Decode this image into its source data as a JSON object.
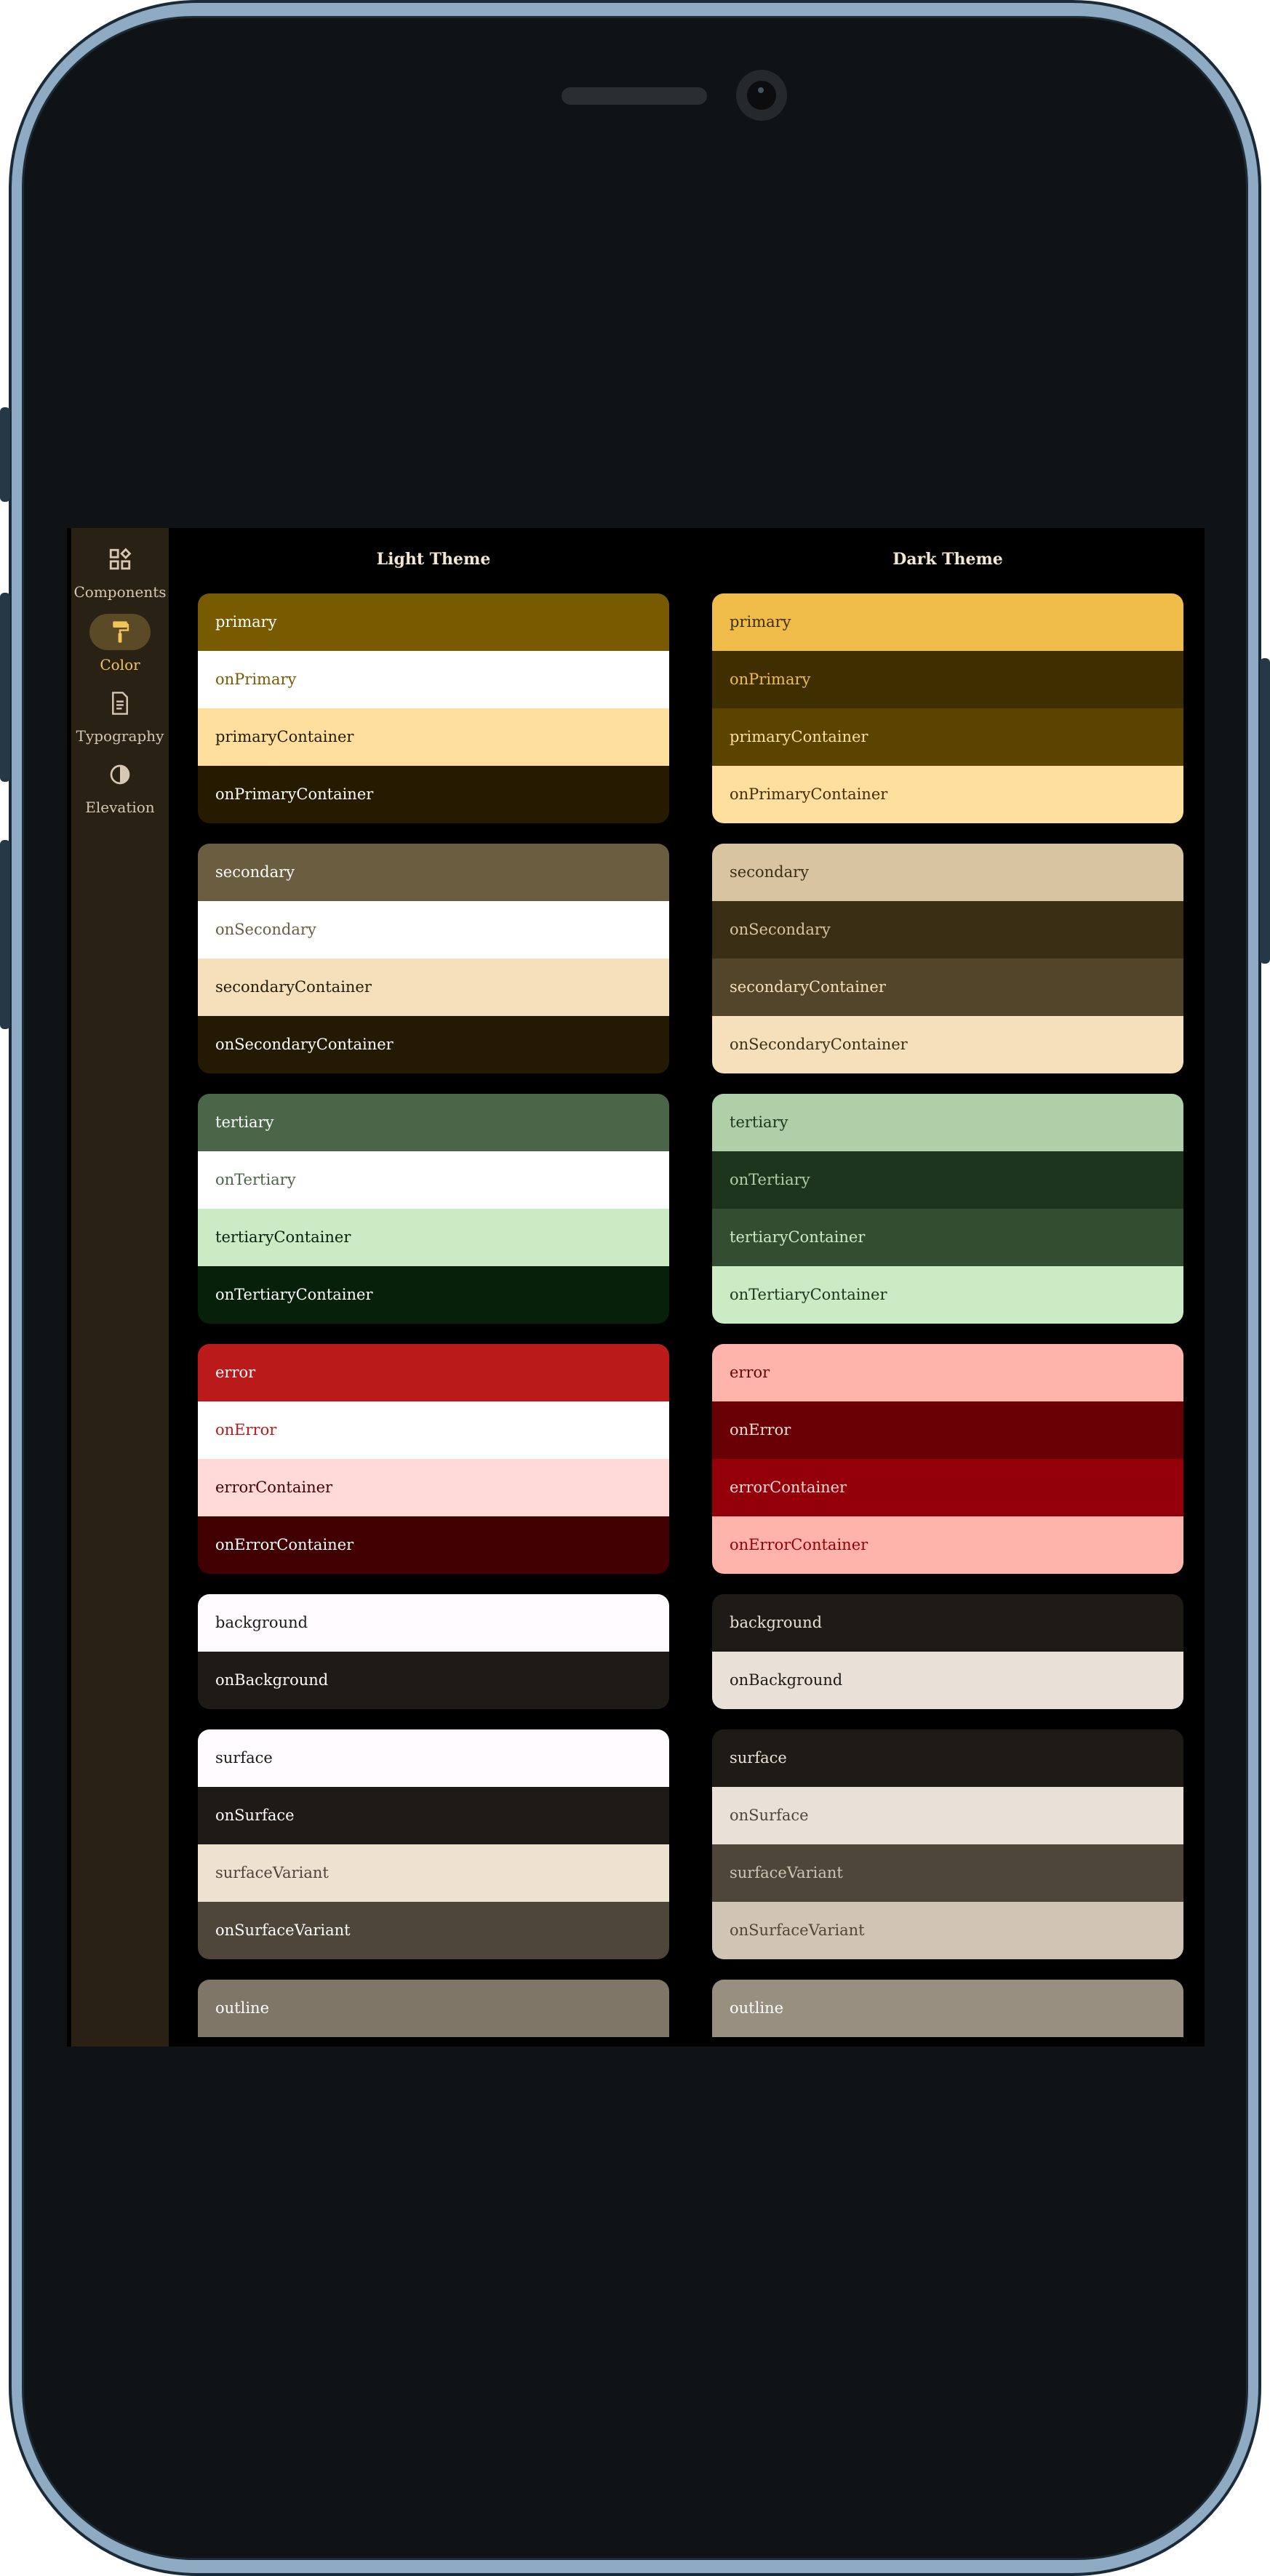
{
  "nav": {
    "items": [
      {
        "label": "Components",
        "icon": "widgets-icon",
        "active": false
      },
      {
        "label": "Color",
        "icon": "paint-roller-icon",
        "active": true
      },
      {
        "label": "Typography",
        "icon": "document-text-icon",
        "active": false
      },
      {
        "label": "Elevation",
        "icon": "contrast-icon",
        "active": false
      }
    ]
  },
  "columns": {
    "light_title": "Light Theme",
    "dark_title": "Dark Theme"
  },
  "light": {
    "primary": [
      "primary",
      "onPrimary",
      "primaryContainer",
      "onPrimaryContainer"
    ],
    "secondary": [
      "secondary",
      "onSecondary",
      "secondaryContainer",
      "onSecondaryContainer"
    ],
    "tertiary": [
      "tertiary",
      "onTertiary",
      "tertiaryContainer",
      "onTertiaryContainer"
    ],
    "error": [
      "error",
      "onError",
      "errorContainer",
      "onErrorContainer"
    ],
    "background": [
      "background",
      "onBackground"
    ],
    "surface": [
      "surface",
      "onSurface",
      "surfaceVariant",
      "onSurfaceVariant"
    ],
    "outline": [
      "outline"
    ]
  },
  "dark": {
    "primary": [
      "primary",
      "onPrimary",
      "primaryContainer",
      "onPrimaryContainer"
    ],
    "secondary": [
      "secondary",
      "onSecondary",
      "secondaryContainer",
      "onSecondaryContainer"
    ],
    "tertiary": [
      "tertiary",
      "onTertiary",
      "tertiaryContainer",
      "onTertiaryContainer"
    ],
    "error": [
      "error",
      "onError",
      "errorContainer",
      "onErrorContainer"
    ],
    "background": [
      "background",
      "onBackground"
    ],
    "surface": [
      "surface",
      "onSurface",
      "surfaceVariant",
      "onSurfaceVariant"
    ],
    "outline": [
      "outline"
    ]
  },
  "colors": {
    "rail_bg": "#2a2115",
    "active_indicator": "#5b4a26",
    "active_label": "#f2c55b",
    "app_bg": "#000000",
    "light_primary": "#785a00",
    "dark_primary": "#f0bd4a",
    "light_error": "#ba1a1a",
    "dark_error": "#ffb4ab"
  }
}
